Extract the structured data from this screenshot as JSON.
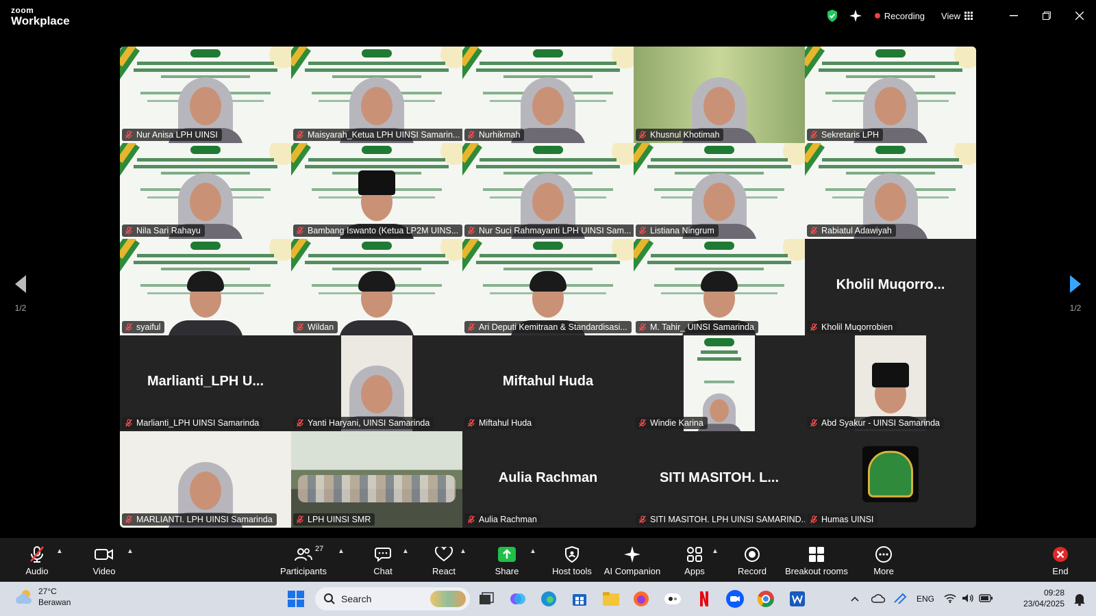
{
  "app": {
    "brand_small": "zoom",
    "brand_big": "Workplace"
  },
  "titlebar": {
    "recording_label": "Recording",
    "view_label": "View"
  },
  "pager": {
    "left": "1/2",
    "right": "1/2"
  },
  "tiles": [
    {
      "name": "Nur Anisa LPH UINSI",
      "kind": "slide",
      "person": "hijab"
    },
    {
      "name": "Maisyarah_Ketua LPH UINSI Samarin...",
      "kind": "slide",
      "person": "hijab"
    },
    {
      "name": "Nurhikmah",
      "kind": "slide",
      "person": "hijab"
    },
    {
      "name": "Khusnul Khotimah",
      "kind": "video",
      "person": "hijab"
    },
    {
      "name": "Sekretaris LPH",
      "kind": "slide",
      "person": "hijab"
    },
    {
      "name": "Nila Sari Rahayu",
      "kind": "slide",
      "person": "hijab"
    },
    {
      "name": "Bambang Iswanto (Ketua LP2M UINS...",
      "kind": "slide",
      "person": "cap"
    },
    {
      "name": "Nur Suci Rahmayanti LPH UINSI Sam...",
      "kind": "slide",
      "person": "hijab"
    },
    {
      "name": "Listiana Ningrum",
      "kind": "slide",
      "person": "hijab"
    },
    {
      "name": "Rabiatul Adawiyah",
      "kind": "slide",
      "person": "hijab"
    },
    {
      "name": "syaiful",
      "kind": "slide",
      "person": "man"
    },
    {
      "name": "Wildan",
      "kind": "slide",
      "person": "man"
    },
    {
      "name": "Ari Deputi Kemitraan & Standardisasi...",
      "kind": "slide",
      "person": "man"
    },
    {
      "name": "M. Tahir_ UINSI Samarinda",
      "kind": "slide",
      "person": "man",
      "active": true
    },
    {
      "name": "Kholil Muqorrobien",
      "kind": "name",
      "display": "Kholil  Muqorro..."
    },
    {
      "name": "Marlianti_LPH UINSI Samarinda",
      "kind": "name",
      "display": "Marlianti_LPH  U..."
    },
    {
      "name": "Yanti Haryani, UINSI Samarinda",
      "kind": "narrow",
      "person": "hijab"
    },
    {
      "name": "Miftahul Huda",
      "kind": "name",
      "display": "Miftahul Huda"
    },
    {
      "name": "Windie Karina",
      "kind": "narrow-slide",
      "person": "hijab"
    },
    {
      "name": "Abd Syakur - UINSI Samarinda",
      "kind": "narrow",
      "person": "cap"
    },
    {
      "name": "MARLIANTI. LPH UINSI Samarinda",
      "kind": "video",
      "person": "hijab"
    },
    {
      "name": "LPH UINSI SMR",
      "kind": "room"
    },
    {
      "name": "Aulia Rachman",
      "kind": "name",
      "display": "Aulia Rachman"
    },
    {
      "name": "SITI MASITOH. LPH UINSI SAMARIND...",
      "kind": "name",
      "display": "SITI  MASITOH.  L..."
    },
    {
      "name": "Humas UINSI",
      "kind": "seal"
    }
  ],
  "toolbar": {
    "audio": "Audio",
    "video": "Video",
    "participants": "Participants",
    "participants_count": "27",
    "chat": "Chat",
    "react": "React",
    "share": "Share",
    "host_tools": "Host tools",
    "ai_companion": "AI Companion",
    "apps": "Apps",
    "record": "Record",
    "breakout_rooms": "Breakout rooms",
    "more": "More",
    "end": "End"
  },
  "taskbar": {
    "temperature": "27°C",
    "weather": "Berawan",
    "search_placeholder": "Search",
    "language": "ENG",
    "time": "09:28",
    "date": "23/04/2025"
  },
  "colors": {
    "active_speaker": "#2ee27a",
    "share_green": "#1fbf4a",
    "end_red": "#e02828",
    "recording_red": "#ff3b3b"
  }
}
